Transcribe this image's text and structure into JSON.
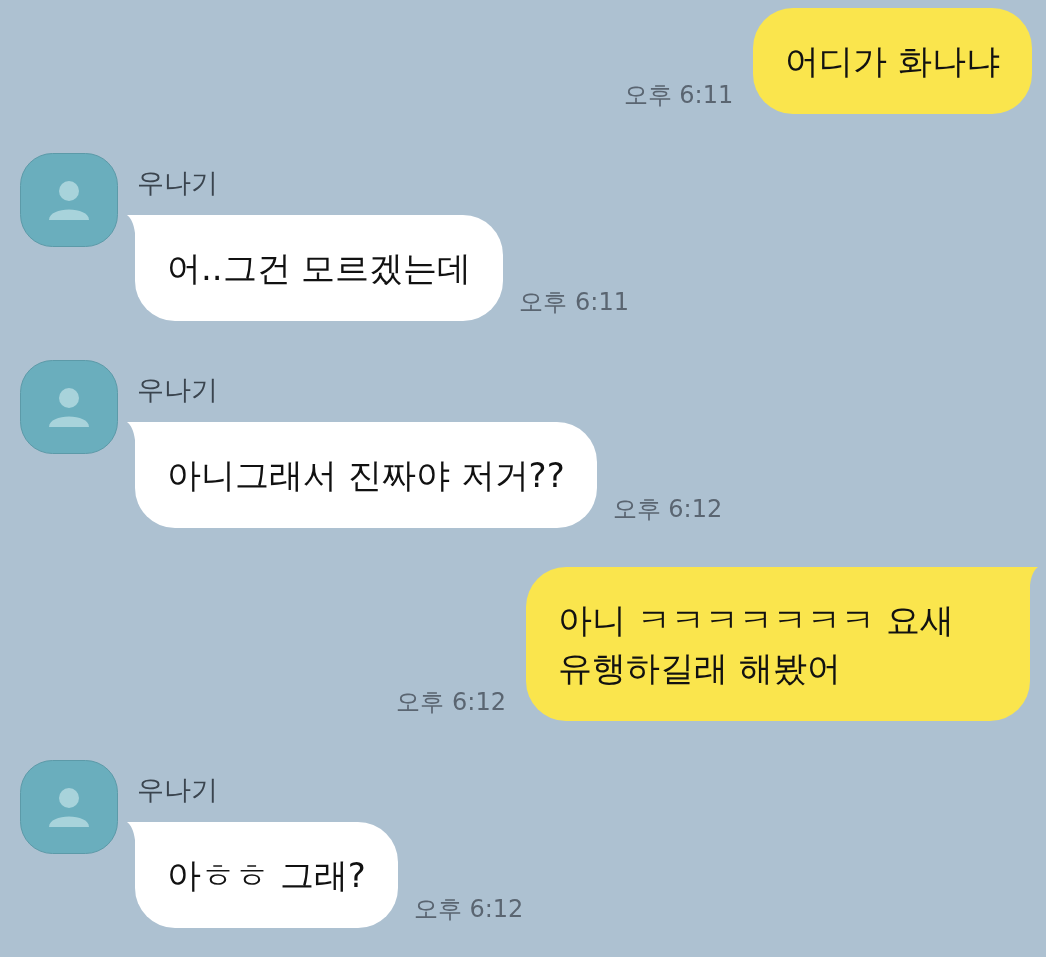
{
  "messages": [
    {
      "kind": "sent",
      "text": "어디가 화나냐",
      "time": "오후 6:11",
      "tail": false
    },
    {
      "kind": "received",
      "sender": "우나기",
      "text": "어..그건 모르겠는데",
      "time": "오후 6:11",
      "tail": true
    },
    {
      "kind": "received",
      "sender": "우나기",
      "text": "아니그래서 진짜야 저거??",
      "time": "오후 6:12",
      "tail": true
    },
    {
      "kind": "sent",
      "text": "아니 ㅋㅋㅋㅋㅋㅋㅋ 요새 유행하길래 해봤어",
      "time": "오후 6:12",
      "tail": true
    },
    {
      "kind": "received",
      "sender": "우나기",
      "text": "아ㅎㅎ 그래?",
      "time": "오후 6:12",
      "tail": true
    }
  ]
}
